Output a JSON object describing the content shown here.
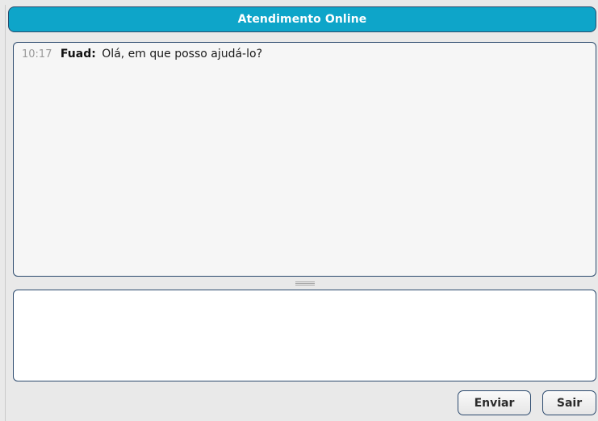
{
  "window": {
    "title": "Atendimento Online"
  },
  "chat_log": {
    "messages": [
      {
        "time": "10:17",
        "author": "Fuad:",
        "text": "Olá, em que posso ajudá-lo?"
      }
    ]
  },
  "compose": {
    "value": "",
    "placeholder": ""
  },
  "actions": {
    "send_label": "Enviar",
    "exit_label": "Sair"
  },
  "colors": {
    "title_bar": "#0ea5c9",
    "border": "#2c4a6e",
    "window_bg": "#e9e9e9",
    "log_bg": "#f6f6f6",
    "timestamp": "#9a9a9a"
  }
}
